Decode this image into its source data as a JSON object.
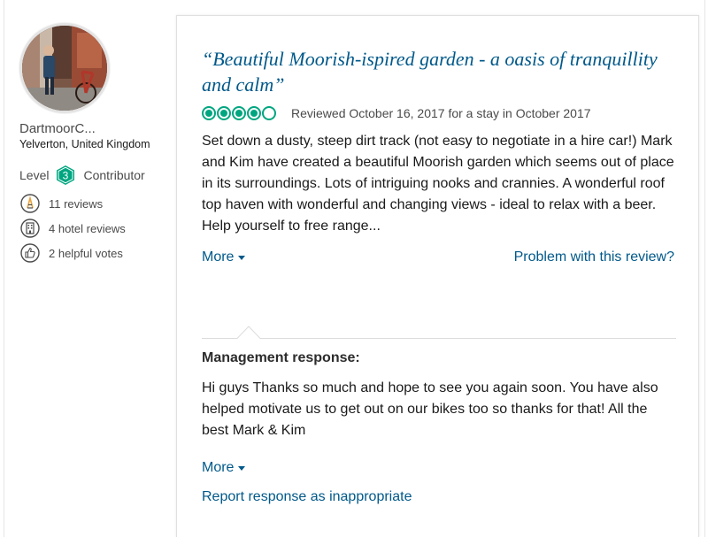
{
  "member": {
    "username": "DartmoorC...",
    "location": "Yelverton, United Kingdom",
    "level_label": "Level",
    "level_number": "3",
    "level_title": "Contributor",
    "stats": [
      {
        "icon": "pencil-icon",
        "text": "11 reviews"
      },
      {
        "icon": "hotel-icon",
        "text": "4 hotel reviews"
      },
      {
        "icon": "thumbs-up-icon",
        "text": "2 helpful votes"
      }
    ]
  },
  "review": {
    "title": "“Beautiful Moorish-ispired garden - a oasis of tranquillity and calm”",
    "rating": 4,
    "rating_max": 5,
    "reviewed_text": "Reviewed October 16, 2017 for a stay in October 2017",
    "body": "Set down a dusty, steep dirt track (not easy to negotiate in a hire car!) Mark and Kim have created a beautiful Moorish garden which seems out of place in its surroundings. Lots of intriguing nooks and crannies. A wonderful roof top haven with wonderful and changing views - ideal to relax with a beer. Help yourself to free range...",
    "more_label": "More",
    "problem_label": "Problem with this review?"
  },
  "management": {
    "title": "Management response:",
    "text": "Hi guys Thanks so much and hope to see you again soon. You have also helped motivate us to get out on our bikes too so thanks for that! All the best Mark & Kim",
    "more_label": "More",
    "report_label": "Report response as inappropriate"
  },
  "colors": {
    "link": "#00598a",
    "bubble": "#00a680",
    "badge": "#00a680"
  }
}
